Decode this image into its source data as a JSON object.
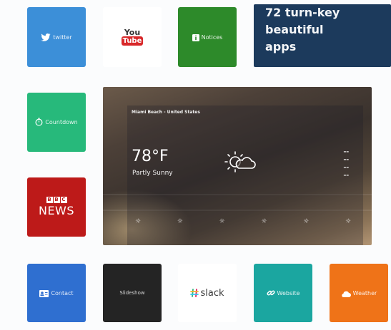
{
  "colors": {
    "twitter": "#3c8fd8",
    "youtube_red": "#d8282a",
    "notices": "#2d8a2a",
    "promo": "#1c3a5c",
    "countdown": "#27b97b",
    "bbc": "#bd1a19",
    "contact": "#2f6fd0",
    "photos": "#242424",
    "website": "#1ba6a0",
    "cloud": "#ef7318"
  },
  "tiles": {
    "twitter": {
      "label": "twitter",
      "icon": "twitter-bird-icon"
    },
    "youtube": {
      "line1": "You",
      "line2": "Tube"
    },
    "notices": {
      "label": "Notices",
      "icon": "info-icon"
    },
    "countdown": {
      "label": "Countdown",
      "icon": "stopwatch-icon"
    },
    "bbc": {
      "boxes": [
        "B",
        "B",
        "C"
      ],
      "news": "NEWS"
    },
    "contact": {
      "label": "Contact",
      "icon": "contact-card-icon"
    },
    "photos": {
      "label": "Slideshow"
    },
    "slack": {
      "label": "slack",
      "icon": "slack-hash-icon"
    },
    "website": {
      "label": "Website",
      "icon": "link-icon"
    },
    "cloud": {
      "label": "Weather",
      "icon": "cloud-icon"
    }
  },
  "promo": {
    "lines": [
      "72 turn-key",
      "beautiful",
      "apps"
    ]
  },
  "weather": {
    "location": "Miami Beach - United States",
    "temperature": "78°F",
    "condition": "Partly Sunny",
    "icon": "partly-cloudy-icon"
  }
}
